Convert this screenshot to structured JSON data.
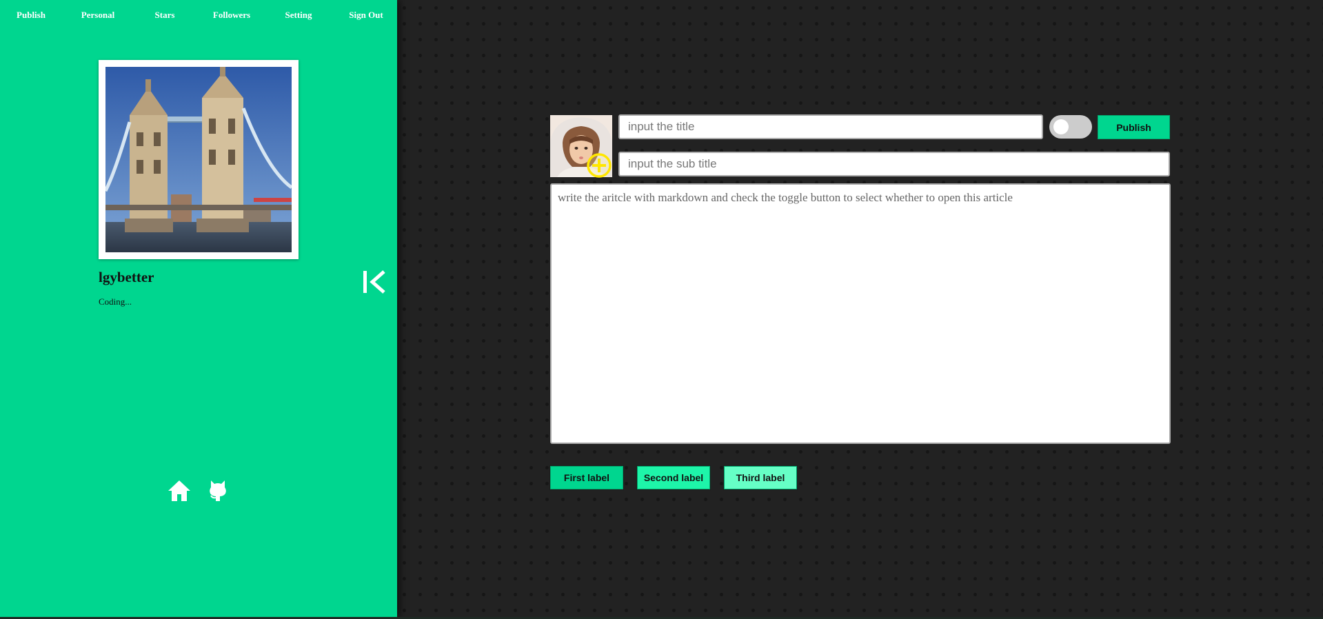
{
  "nav": {
    "items": [
      {
        "label": "Publish"
      },
      {
        "label": "Personal"
      },
      {
        "label": "Stars"
      },
      {
        "label": "Followers"
      },
      {
        "label": "Setting"
      },
      {
        "label": "Sign Out"
      }
    ]
  },
  "profile": {
    "username": "lgybetter",
    "bio": "Coding..."
  },
  "editor": {
    "title_placeholder": "input the title",
    "subtitle_placeholder": "input the sub title",
    "article_placeholder": "write the aritcle with markdown and check the toggle button to select whether to open this article",
    "publish_label": "Publish",
    "toggle_on": false
  },
  "labels": [
    {
      "label": "First label"
    },
    {
      "label": "Second label"
    },
    {
      "label": "Third label"
    }
  ],
  "colors": {
    "accent": "#00d68f",
    "background": "#222222",
    "plus_badge": "#ffe600"
  },
  "icons": {
    "collapse": "collapse-left-icon",
    "home": "home-icon",
    "github": "github-icon",
    "add": "plus-circle-icon"
  }
}
